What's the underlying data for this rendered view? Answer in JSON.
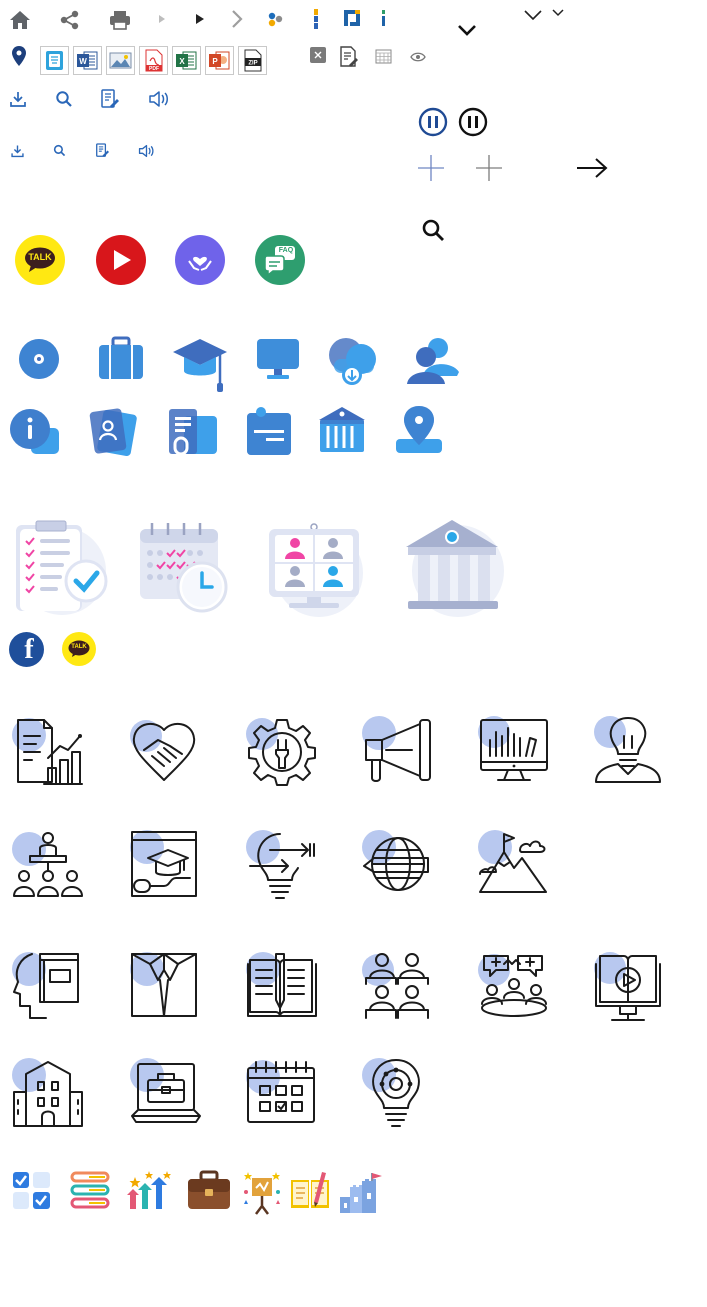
{
  "badges": {
    "talk": "TALK",
    "faq": "FAQ",
    "talk_small": "TALK",
    "pdf": "PDF",
    "zip": "ZIP"
  },
  "icons": {
    "toolbar": [
      "home-icon",
      "share-icon",
      "print-icon",
      "caret-right-small-icon",
      "caret-right-icon",
      "chevron-right-icon",
      "dots-logo-icon",
      "info-bar-icon",
      "corner-logo-icon",
      "info-small-icon",
      "chevron-down-bold-icon",
      "chevron-down-icon",
      "chevron-down-small-icon"
    ],
    "file_types": [
      "location-pin-icon",
      "hwp-file-icon",
      "word-file-icon",
      "image-file-icon",
      "pdf-file-icon",
      "excel-file-icon",
      "powerpoint-file-icon",
      "zip-file-icon",
      "close-box-icon",
      "edit-document-icon",
      "calendar-grid-icon",
      "eye-icon"
    ],
    "actions_large": [
      "download-icon",
      "search-icon",
      "memo-edit-icon",
      "speaker-icon"
    ],
    "actions_small": [
      "download-icon",
      "search-icon",
      "memo-edit-icon",
      "speaker-icon"
    ],
    "controls": [
      "pause-blue-icon",
      "pause-black-icon",
      "plus-blue-icon",
      "plus-gray-icon",
      "arrow-right-icon",
      "search-large-icon"
    ],
    "social_circles": [
      "kakaotalk-icon",
      "youtube-icon",
      "donation-heart-icon",
      "faq-chat-icon"
    ],
    "service_blue": [
      "disc-icon",
      "briefcase-icon",
      "graduation-cap-icon",
      "monitor-icon",
      "cloud-download-icon",
      "users-icon",
      "info-card-icon",
      "id-card-icon",
      "document-folder-icon",
      "board-icon",
      "institution-icon",
      "map-pin-icon"
    ],
    "illustrations": [
      "checklist-illustration",
      "calendar-clock-illustration",
      "video-meeting-illustration",
      "museum-illustration"
    ],
    "social_small": [
      "facebook-icon",
      "kakaotalk-small-icon"
    ],
    "line_icons": [
      "analytics-report-icon",
      "handshake-icon",
      "gear-wrench-icon",
      "megaphone-icon",
      "dashboard-monitor-icon",
      "lightbulb-mentor-icon",
      "team-presentation-icon",
      "online-course-icon",
      "idea-bulb-icon",
      "global-education-icon",
      "goal-mountain-icon",
      "student-book-icon",
      "uniform-shirt-icon",
      "open-book-icon",
      "classroom-icon",
      "group-discussion-icon",
      "video-lecture-icon",
      "school-building-icon",
      "laptop-briefcase-icon",
      "calendar-schedule-icon",
      "creative-bulb-icon"
    ],
    "color_small": [
      "checkbox-list-icon",
      "books-stack-icon",
      "growth-arrows-icon",
      "brown-briefcase-icon",
      "achievement-stars-icon",
      "reading-book-icon",
      "goal-castle-icon"
    ]
  },
  "colors": {
    "kakao_yellow": "#FFE812",
    "youtube_red": "#D8161B",
    "donation_purple": "#6F63EA",
    "faq_green": "#2E9E6F",
    "service_blue": "#3EA0EA",
    "service_dark": "#3F6DBE",
    "facebook_blue": "#1F4F9B",
    "accent_blob": "#B8C8EF"
  }
}
